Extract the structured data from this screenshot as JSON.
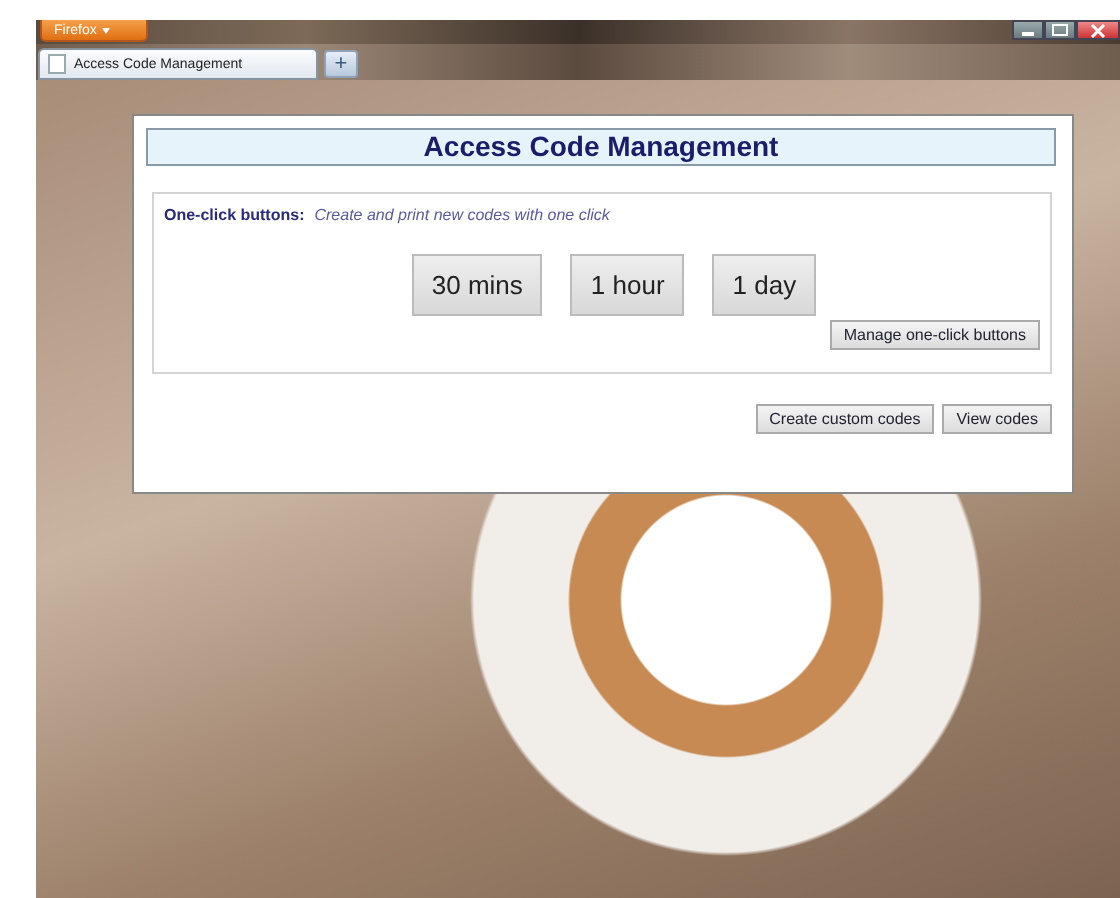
{
  "browser": {
    "menu_button": "Firefox",
    "tabs": [
      {
        "label": "Access Code Management",
        "selected": true
      }
    ],
    "new_tab_button": "+"
  },
  "page": {
    "title": "Access Code Management",
    "one_click": {
      "label": "One-click buttons:",
      "description": "Create and print new codes with one click",
      "buttons": [
        "30 mins",
        "1 hour",
        "1 day"
      ],
      "manage_button": "Manage one-click buttons"
    },
    "actions": [
      "Create custom codes",
      "View codes"
    ]
  }
}
